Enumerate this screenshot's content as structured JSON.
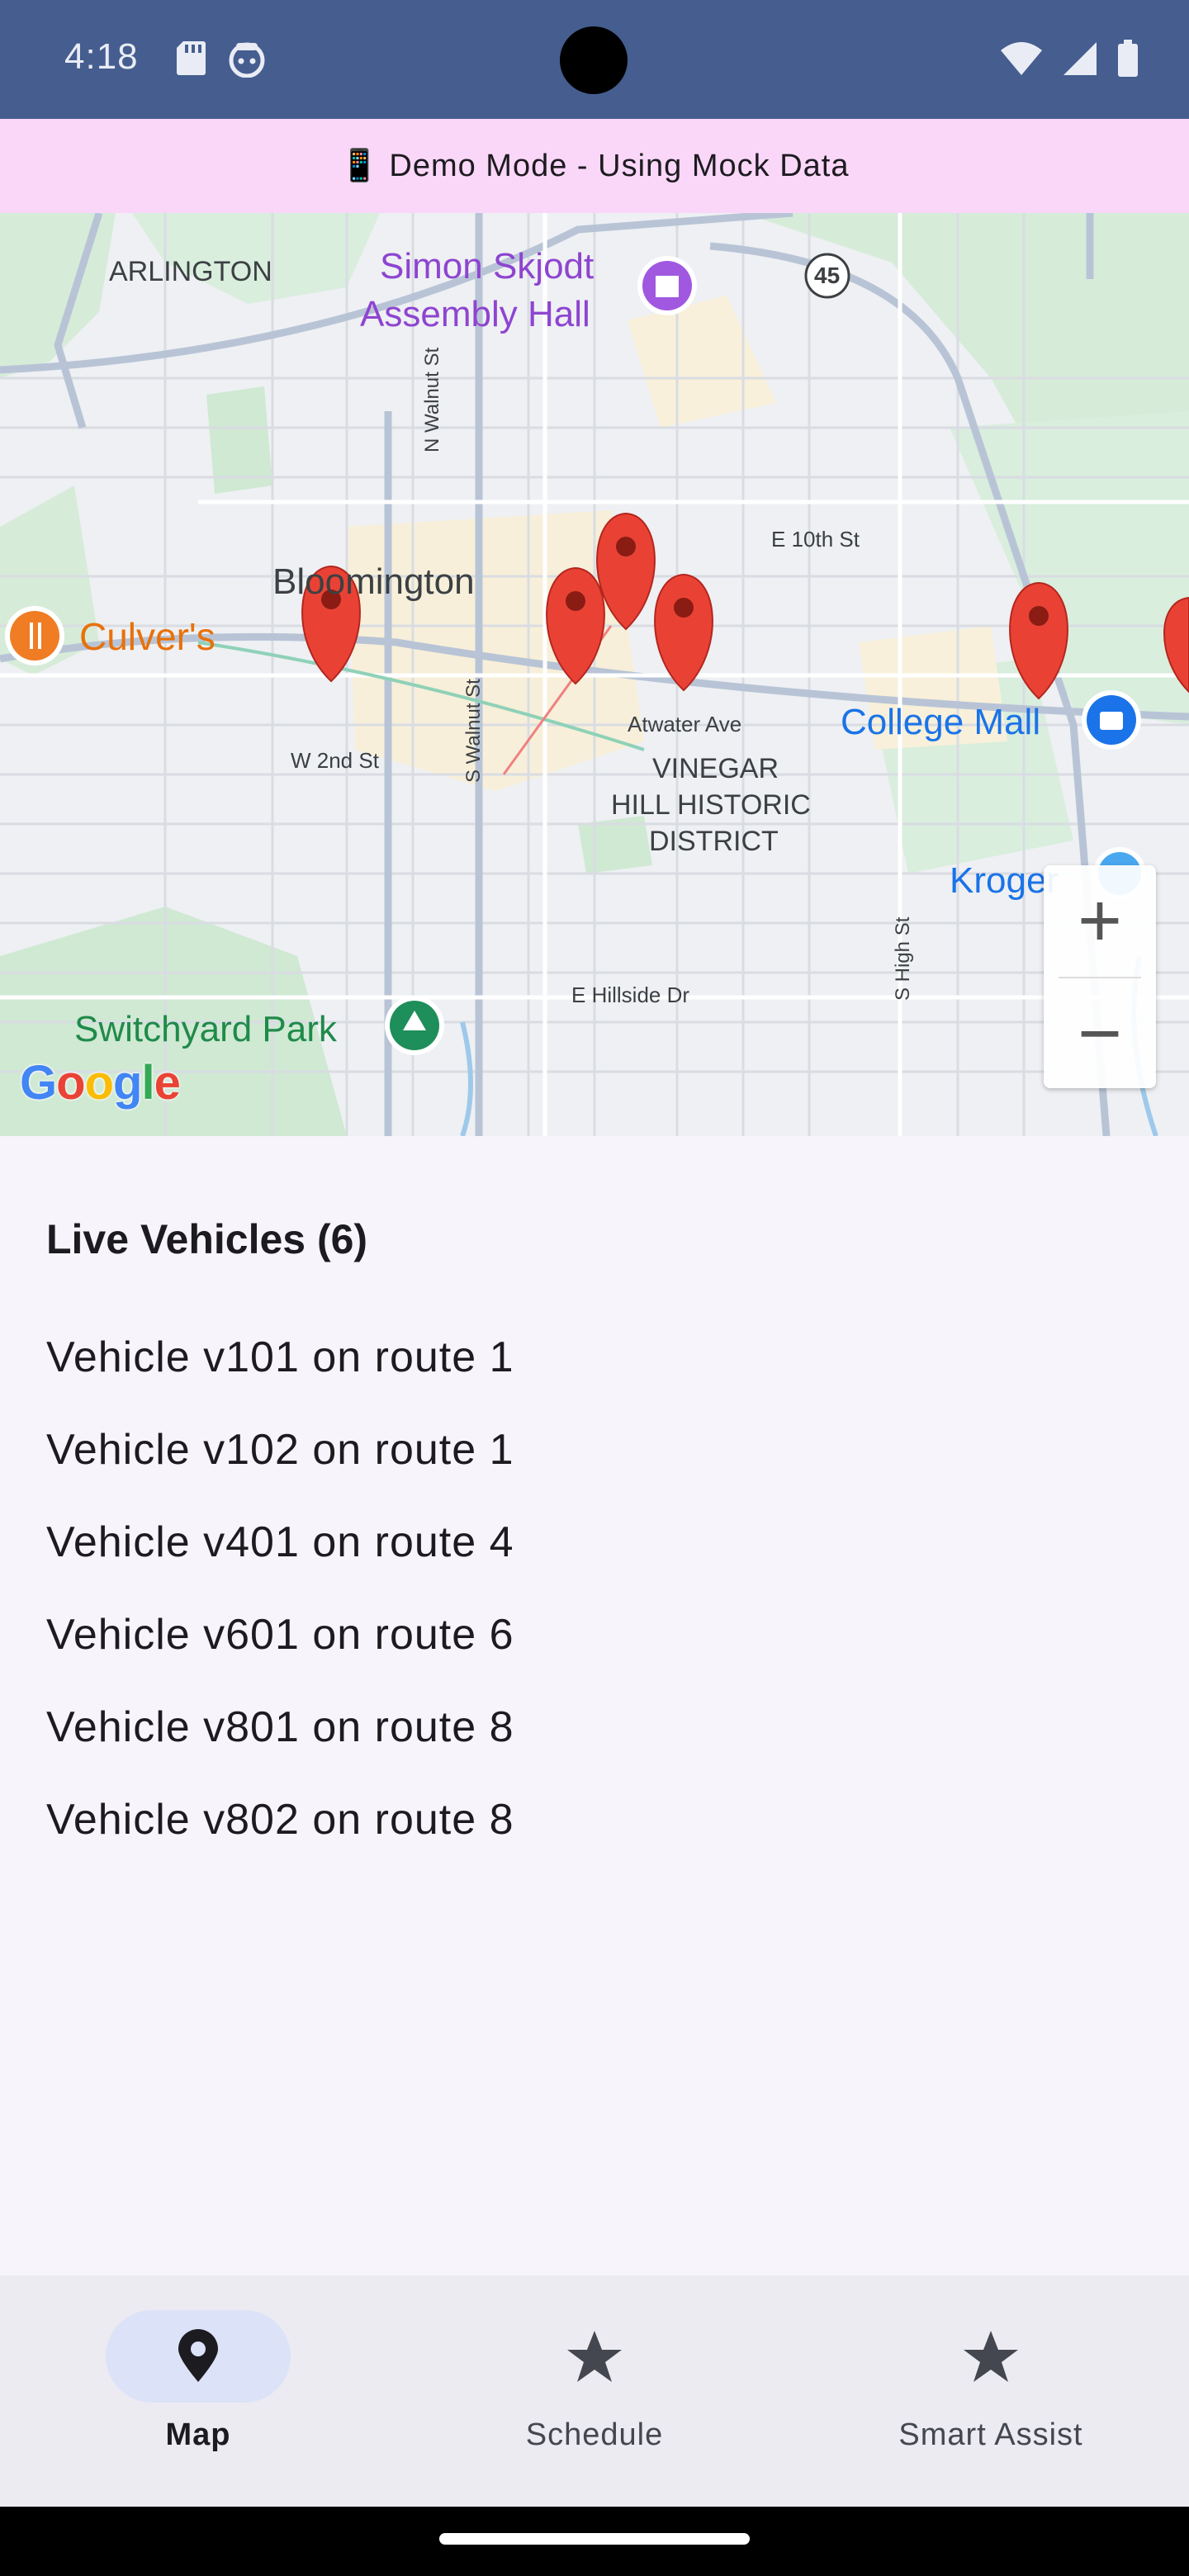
{
  "status_bar": {
    "time": "4:18"
  },
  "banner": {
    "icon": "phone-icon",
    "text": "📱 Demo Mode - Using Mock Data"
  },
  "map": {
    "labels": {
      "arlington": "ARLINGTON",
      "simon_line1": "Simon Skjodt",
      "simon_line2": "Assembly Hall",
      "highway": "45",
      "bloomington": "Bloomington",
      "culvers": "Culver's",
      "e10th": "E 10th St",
      "n_walnut": "N Walnut St",
      "s_walnut": "S Walnut St",
      "w2nd": "W 2nd St",
      "atwater": "Atwater Ave",
      "college_mall": "College Mall",
      "vinegar1": "VINEGAR",
      "vinegar2": "HILL HISTORIC",
      "vinegar3": "DISTRICT",
      "kroger": "Kroger",
      "s_high": "S High St",
      "hillside": "E Hillside Dr",
      "switchyard": "Switchyard Park"
    },
    "zoom_in": "+",
    "zoom_out": "−",
    "colors": {
      "marker": "#e94235",
      "park_label": "#208a4a",
      "poi_purple": "#8e44d0",
      "poi_blue": "#1a73e8",
      "poi_orange": "#e8710a"
    }
  },
  "vehicles": {
    "title": "Live Vehicles (6)",
    "items": [
      "Vehicle v101 on route 1",
      "Vehicle v102 on route 1",
      "Vehicle v401 on route 4",
      "Vehicle v601 on route 6",
      "Vehicle v801 on route 8",
      "Vehicle v802 on route 8"
    ]
  },
  "nav": {
    "items": [
      {
        "label": "Map",
        "icon": "map-pin-icon",
        "active": true
      },
      {
        "label": "Schedule",
        "icon": "star-icon",
        "active": false
      },
      {
        "label": "Smart Assist",
        "icon": "star-icon",
        "active": false
      }
    ]
  }
}
